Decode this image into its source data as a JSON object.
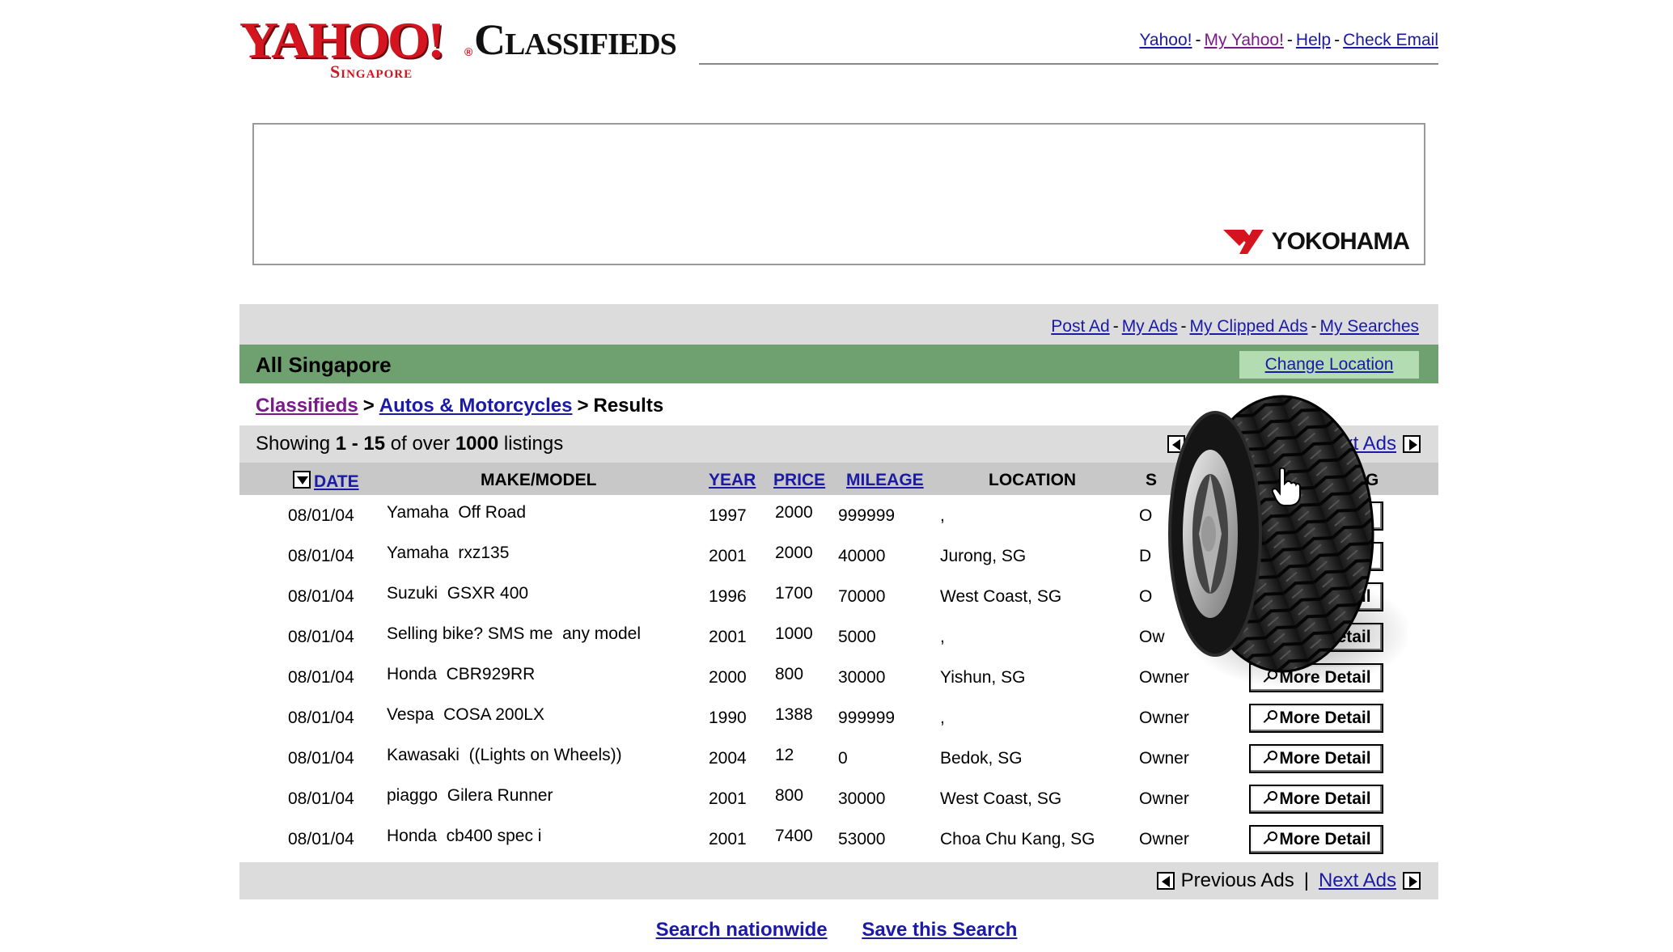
{
  "header": {
    "logo_text": "YAHOO!",
    "logo_reg": "®",
    "logo_region": "Singapore",
    "logo_section": "Classifieds",
    "links": [
      "Yahoo!",
      "My Yahoo!",
      "Help",
      "Check Email"
    ],
    "separator": "-"
  },
  "banner": {
    "brand": "YOKOHAMA"
  },
  "account_nav": {
    "links": [
      "Post Ad",
      "My Ads",
      "My Clipped Ads",
      "My Searches"
    ],
    "separator": "-"
  },
  "location": {
    "title": "All Singapore",
    "change_label": "Change Location"
  },
  "breadcrumb": {
    "items": [
      "Classifieds",
      "Autos & Motorcycles"
    ],
    "separator": ">",
    "current": "Results"
  },
  "results": {
    "showing_prefix": "Showing ",
    "range": "1 - 15",
    "of_text": " of over ",
    "total": "1000",
    "suffix": " listings"
  },
  "pager": {
    "next_label": "Next Ads",
    "next_partial": "xt Ads",
    "prev_label": "Previous Ads",
    "pipe": "|"
  },
  "table": {
    "headers": {
      "date": "DATE",
      "make_model": "MAKE/MODEL",
      "year": "YEAR",
      "price": "PRICE",
      "mileage": "MILEAGE",
      "location": "LOCATION",
      "seller_partial": "S",
      "listing_partial": "TING"
    },
    "detail_label": "More Detail",
    "detail_partials": [
      "tail",
      "tail",
      "tail",
      "Detail",
      "ore Detail"
    ],
    "rows": [
      {
        "date": "08/01/04",
        "make": "Yamaha",
        "model": "Off Road",
        "year": "1997",
        "price": "2000",
        "mileage": "999999",
        "location": ",",
        "seller": "O"
      },
      {
        "date": "08/01/04",
        "make": "Yamaha",
        "model": "rxz135",
        "year": "2001",
        "price": "2000",
        "mileage": "40000",
        "location": "Jurong, SG",
        "seller": "D"
      },
      {
        "date": "08/01/04",
        "make": "Suzuki",
        "model": "GSXR 400",
        "year": "1996",
        "price": "1700",
        "mileage": "70000",
        "location": "West Coast, SG",
        "seller": "O"
      },
      {
        "date": "08/01/04",
        "make": "Selling bike? SMS me",
        "model": "any model",
        "year": "2001",
        "price": "1000",
        "mileage": "5000",
        "location": ",",
        "seller": "Ow"
      },
      {
        "date": "08/01/04",
        "make": "Honda",
        "model": "CBR929RR",
        "year": "2000",
        "price": "800",
        "mileage": "30000",
        "location": "Yishun, SG",
        "seller": "Owner"
      },
      {
        "date": "08/01/04",
        "make": "Vespa",
        "model": "COSA 200LX",
        "year": "1990",
        "price": "1388",
        "mileage": "999999",
        "location": ",",
        "seller": "Owner"
      },
      {
        "date": "08/01/04",
        "make": "Kawasaki",
        "model": "((Lights on Wheels))",
        "year": "2004",
        "price": "12",
        "mileage": "0",
        "location": "Bedok, SG",
        "seller": "Owner"
      },
      {
        "date": "08/01/04",
        "make": "piaggo",
        "model": "Gilera Runner",
        "year": "2001",
        "price": "800",
        "mileage": "30000",
        "location": "West Coast, SG",
        "seller": "Owner"
      },
      {
        "date": "08/01/04",
        "make": "Honda",
        "model": "cb400 spec i",
        "year": "2001",
        "price": "7400",
        "mileage": "53000",
        "location": "Choa Chu Kang, SG",
        "seller": "Owner"
      }
    ]
  },
  "footer": {
    "links": [
      "Search nationwide",
      "Save this Search"
    ]
  },
  "colors": {
    "link": "#1a1aa6",
    "visited": "#7a1a8a",
    "yahoo_red": "#d4141e",
    "location_bar": "#6fa06f",
    "change_location_bg": "#b3dcb3",
    "gray_bar": "#dcdcdc",
    "table_header": "#c8c8c8"
  },
  "icons": {
    "sort": "sort-down-arrow-icon",
    "prev": "prev-arrow-icon",
    "next": "next-arrow-icon",
    "detail": "magnifier-icon",
    "tire": "tire-ad-image",
    "cursor": "hand-cursor-icon"
  }
}
